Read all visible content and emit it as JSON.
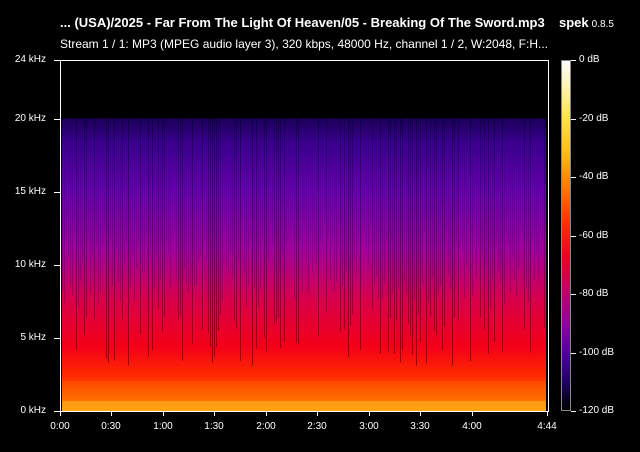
{
  "window": {
    "title": "... (USA)/2025 - Far From The Light Of Heaven/05 - Breaking Of The Sword.mp3",
    "app_name": "spek",
    "app_version": "0.8.5"
  },
  "stream_info": "Stream 1 / 1: MP3 (MPEG audio layer 3), 320 kbps, 48000 Hz, channel 1 / 2, W:2048, F:H...",
  "colors": {
    "background": "#000000",
    "text": "#ffffff",
    "palette": [
      "#000000",
      "#1e0064",
      "#4f00a0",
      "#8c00a2",
      "#c2006a",
      "#ec0020",
      "#ff3100",
      "#ff7a00",
      "#ffbe1a",
      "#ffe54a",
      "#ffffff"
    ]
  },
  "chart_data": {
    "type": "heatmap",
    "title": "",
    "xlabel": "",
    "ylabel": "",
    "duration_seconds": 284,
    "cutoff_khz": 20,
    "xlim": [
      0,
      284
    ],
    "ylim_khz": [
      0,
      24
    ],
    "x_ticks": [
      "0:00",
      "0:30",
      "1:00",
      "1:30",
      "2:00",
      "2:30",
      "3:00",
      "3:30",
      "4:00",
      "4:44"
    ],
    "x_tick_seconds": [
      0,
      30,
      60,
      90,
      120,
      150,
      180,
      210,
      240,
      284
    ],
    "y_ticks": [
      "0 kHz",
      "5 kHz",
      "10 kHz",
      "15 kHz",
      "20 kHz",
      "24 kHz"
    ],
    "y_tick_khz": [
      0,
      5,
      10,
      15,
      20,
      24
    ],
    "colorbar": {
      "labels": [
        "0 dB",
        "-20 dB",
        "-40 dB",
        "-60 dB",
        "-80 dB",
        "-100 dB",
        "-120 dB"
      ],
      "db_values": [
        0,
        -20,
        -40,
        -60,
        -80,
        -100,
        -120
      ],
      "range_db": [
        -120,
        0
      ]
    }
  }
}
